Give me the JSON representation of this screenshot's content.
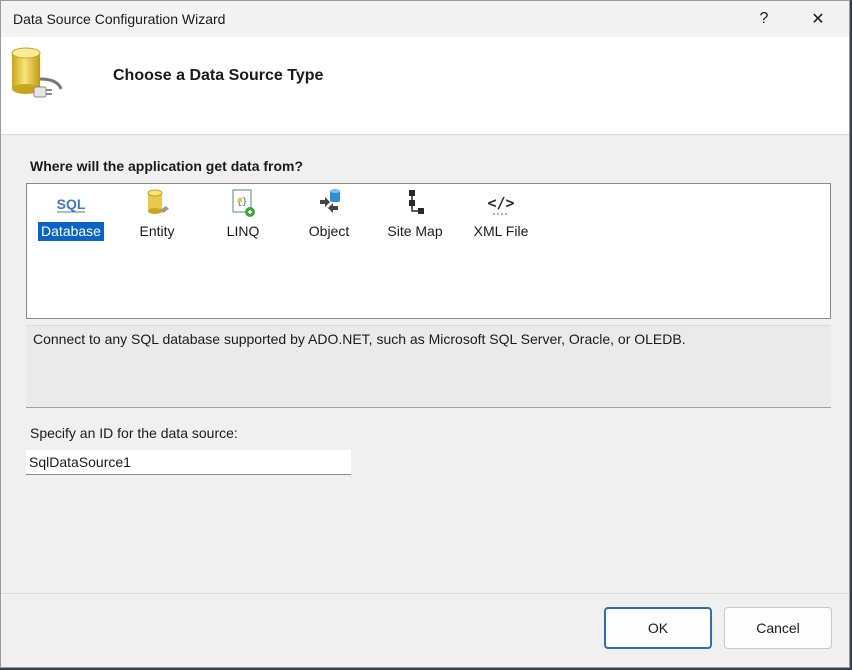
{
  "window": {
    "title": "Data Source Configuration Wizard"
  },
  "titlebar": {
    "help": "?",
    "close": "✕"
  },
  "header": {
    "title": "Choose a Data Source Type",
    "icon": "database-plug-icon"
  },
  "question": "Where will the application get data from?",
  "data_source_types": [
    {
      "label": "Database",
      "icon": "sql-icon",
      "selected": true
    },
    {
      "label": "Entity",
      "icon": "entity-icon",
      "selected": false
    },
    {
      "label": "LINQ",
      "icon": "linq-icon",
      "selected": false
    },
    {
      "label": "Object",
      "icon": "object-icon",
      "selected": false
    },
    {
      "label": "Site Map",
      "icon": "site-map-icon",
      "selected": false
    },
    {
      "label": "XML File",
      "icon": "xml-file-icon",
      "selected": false
    }
  ],
  "description": "Connect to any SQL database supported by ADO.NET, such as Microsoft SQL Server, Oracle, or OLEDB.",
  "id_field": {
    "label": "Specify an ID for the data source:",
    "value": "SqlDataSource1"
  },
  "buttons": {
    "ok": "OK",
    "cancel": "Cancel"
  },
  "colors": {
    "selection": "#0a64c8",
    "default_button_border": "#2e6cc0"
  }
}
